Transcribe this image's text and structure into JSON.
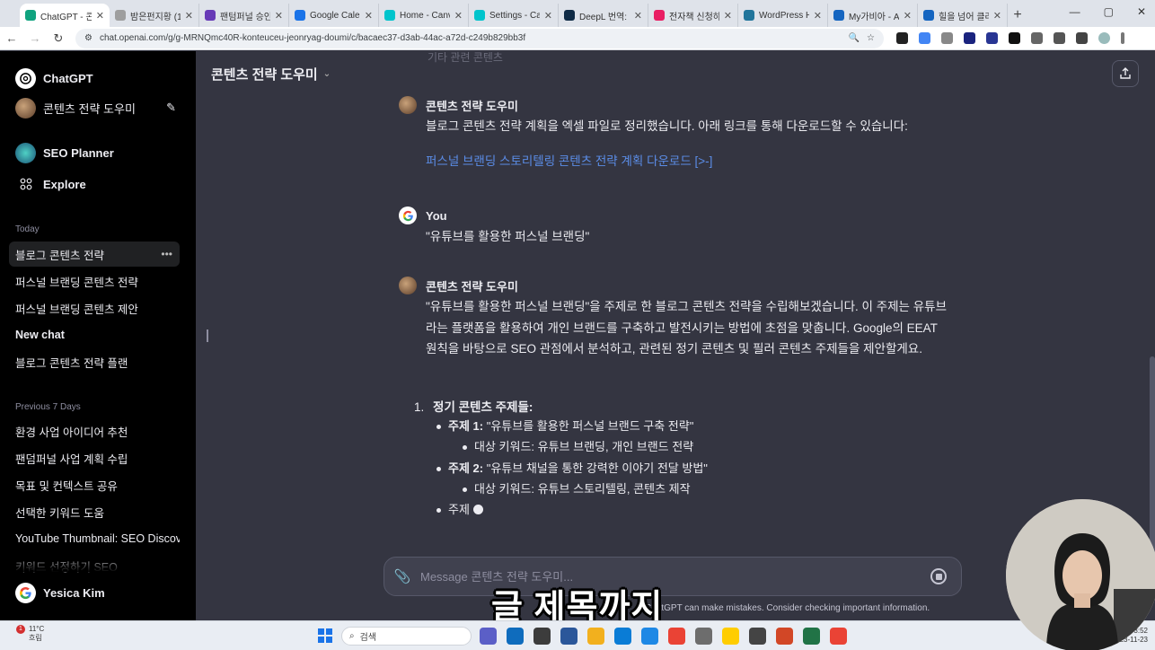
{
  "browser": {
    "tabs": [
      {
        "label": "ChatGPT - 콘텐",
        "color": "#10a37f",
        "active": true
      },
      {
        "label": "밤은펀지황 (1·",
        "color": "#9e9e9e"
      },
      {
        "label": "팬텀퍼널 승인",
        "color": "#673ab7"
      },
      {
        "label": "Google Calend",
        "color": "#1a73e8"
      },
      {
        "label": "Home - Canva",
        "color": "#00c4cc"
      },
      {
        "label": "Settings - Can",
        "color": "#00c4cc"
      },
      {
        "label": "DeepL 번역: AI",
        "color": "#0f2b46"
      },
      {
        "label": "전자책 신청하",
        "color": "#e91e63"
      },
      {
        "label": "WordPress Ho",
        "color": "#21759b"
      },
      {
        "label": "My가비아 - AI",
        "color": "#1565c0"
      },
      {
        "label": "힐을 넘어 클라",
        "color": "#1565c0"
      }
    ],
    "new_tab": "+",
    "url": "chat.openai.com/g/g-MRNQmc40R-konteuceu-jeonryag-doumi/c/bacaec37-d3ab-44ac-a72d-c249b829bb3f"
  },
  "sidebar": {
    "brand": "ChatGPT",
    "gpt_name": "콘텐츠 전략 도우미",
    "seo_planner": "SEO Planner",
    "explore": "Explore",
    "section_today": "Today",
    "today_items": [
      "블로그 콘텐츠 전략",
      "퍼스널 브랜딩 콘텐츠 전략",
      "퍼스널 브랜딩 콘텐츠 제안",
      "New chat",
      "블로그 콘텐츠 전략 플랜"
    ],
    "section_prev7": "Previous 7 Days",
    "prev_items": [
      "환경 사업 아이디어 추천",
      "팬덤퍼널 사업 계획 수립",
      "목표 및 컨텍스트 공유",
      "선택한 키워드 도움",
      "YouTube Thumbnail: SEO Discove",
      "키워드 선정하기 SEO"
    ],
    "user_name": "Yesica Kim"
  },
  "header": {
    "title": "콘텐츠 전략 도우미",
    "caret": "⌄"
  },
  "faint_top": "기타 관련 콘텐츠",
  "messages": [
    {
      "author": "콘텐츠 전략 도우미",
      "text": "블로그 콘텐츠 전략 계획을 엑셀 파일로 정리했습니다. 아래 링크를 통해 다운로드할 수 있습니다:",
      "link": "퍼스널 브랜딩 스토리텔링 콘텐츠 전략 계획 다운로드 [>-]"
    },
    {
      "author": "You",
      "text": "\"유튜브를 활용한 퍼스널 브랜딩\""
    },
    {
      "author": "콘텐츠 전략 도우미",
      "text": "\"유튜브를 활용한 퍼스널 브랜딩\"을 주제로 한 블로그 콘텐츠 전략을 수립해보겠습니다. 이 주제는 유튜브라는 플랫폼을 활용하여 개인 브랜드를 구축하고 발전시키는 방법에 초점을 맞춥니다. Google의 EEAT 원칙을 바탕으로 SEO 관점에서 분석하고, 관련된 정기 콘텐츠 및 필러 콘텐츠 주제들을 제안할게요.",
      "list_number": "1.",
      "list_title": "정기 콘텐츠 주제들:",
      "items": [
        {
          "label": "주제 1:",
          "text": "\"유튜브를 활용한 퍼스널 브랜드 구축 전략\"",
          "sub": "대상 키워드: 유튜브 브랜딩, 개인 브랜드 전략"
        },
        {
          "label": "주제 2:",
          "text": "\"유튜브 채널을 통한 강력한 이야기 전달 방법\"",
          "sub": "대상 키워드: 유튜브 스토리텔링, 콘텐츠 제작"
        },
        {
          "label": "주제",
          "text": ""
        }
      ]
    }
  ],
  "composer": {
    "placeholder": "Message 콘텐츠 전략 도우미..."
  },
  "disclaimer": "ChatGPT can make mistakes. Consider checking important information.",
  "subtitle": "글 제목까지",
  "taskbar": {
    "weather_temp": "11°C",
    "weather_desc": "흐림",
    "badge": "1",
    "search": "검색",
    "time": "오후 3:52",
    "date": "2023-11-23",
    "app_colors": [
      "#5b5fc7",
      "#0f6cbd",
      "#3c3c3c",
      "#2b579a",
      "#f2b01e",
      "#0a7cd6",
      "#1e88e5",
      "#ea4335",
      "#6d6d6d",
      "#ffcd00",
      "#444444",
      "#d24726",
      "#217346",
      "#ea4335"
    ]
  },
  "colors": {
    "sidebar_bg": "#000000",
    "main_bg": "#343541",
    "link": "#5b8de8"
  }
}
